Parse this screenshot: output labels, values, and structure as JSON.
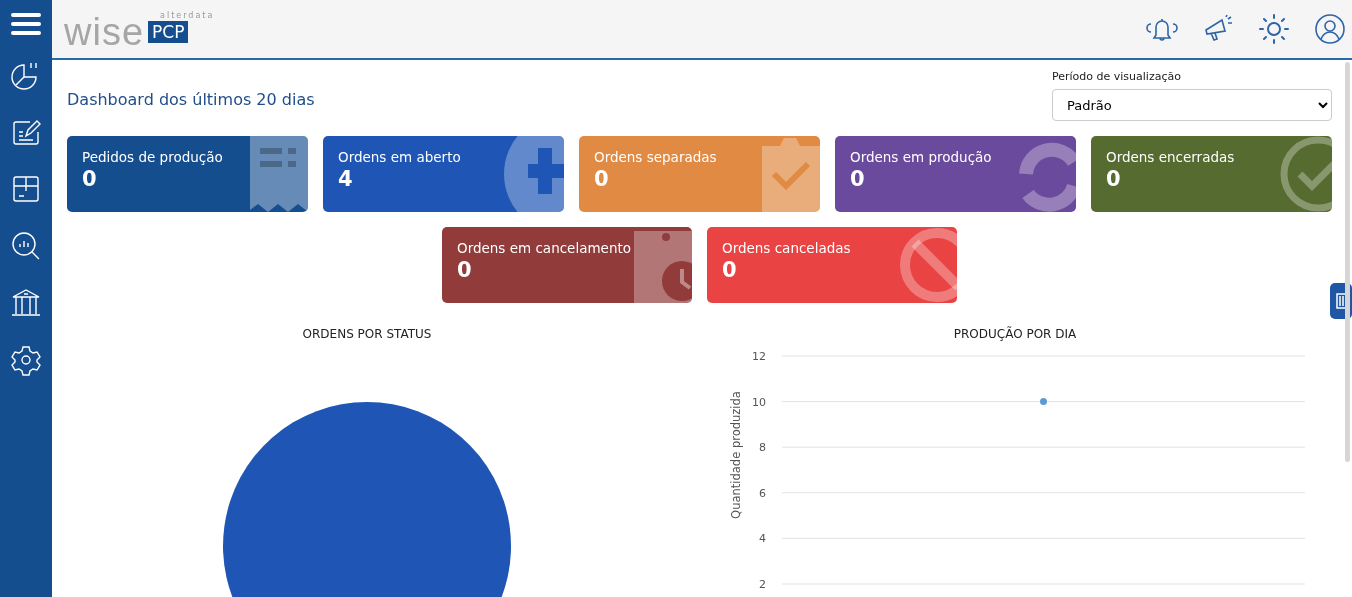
{
  "logo": {
    "brand": "alterdata",
    "name": "wise",
    "product": "PCP"
  },
  "page_title": "Dashboard dos últimos 20 dias",
  "period": {
    "label": "Período de visualização",
    "value": "Padrão"
  },
  "cards": [
    {
      "label": "Pedidos de produção",
      "value": "0",
      "color": "#154e8f",
      "kind": "receipt"
    },
    {
      "label": "Ordens em aberto",
      "value": "4",
      "color": "#1f56b6",
      "kind": "plus"
    },
    {
      "label": "Ordens separadas",
      "value": "0",
      "color": "#e08a43",
      "kind": "clipboard-check"
    },
    {
      "label": "Ordens em produção",
      "value": "0",
      "color": "#6a4a9c",
      "kind": "refresh"
    },
    {
      "label": "Ordens encerradas",
      "value": "0",
      "color": "#556b30",
      "kind": "check"
    },
    {
      "label": "Ordens em cancelamento",
      "value": "0",
      "color": "#913b3b",
      "kind": "clipboard-clock"
    },
    {
      "label": "Ordens canceladas",
      "value": "0",
      "color": "#e94343",
      "kind": "forbidden"
    }
  ],
  "status_chart": {
    "title": "ORDENS POR STATUS"
  },
  "production_chart": {
    "chart_data": {
      "type": "line",
      "title": "PRODUÇÃO POR DIA",
      "ylabel": "Quantidade produzida",
      "ylim": [
        2,
        12
      ],
      "yticks": [
        2,
        4,
        6,
        8,
        10,
        12
      ],
      "grid": true,
      "series": [
        {
          "color": "#5b9bd5",
          "marker": true,
          "values": [
            10
          ]
        }
      ]
    }
  }
}
